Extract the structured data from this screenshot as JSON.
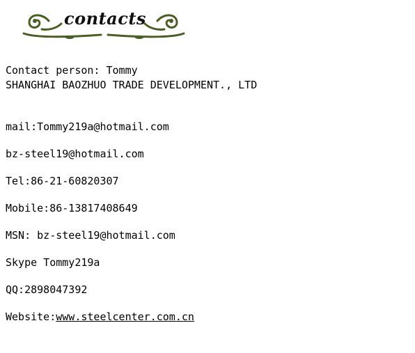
{
  "header": {
    "title": "contacts",
    "ornament_color": "#4a5e23"
  },
  "contact": {
    "person_line": "Contact person: Tommy",
    "company_line": "SHANGHAI BAOZHUO TRADE DEVELOPMENT., LTD",
    "mail_line": "mail:Tommy219a@hotmail.com",
    "mail2_line": "bz-steel19@hotmail.com",
    "tel_line": "Tel:86-21-60820307",
    "mobile_line": "Mobile:86-13817408649",
    "msn_line": "MSN: bz-steel19@hotmail.com",
    "skype_line": "Skype Tommy219a",
    "qq_line": "QQ:2898047392",
    "website_label": "Website:",
    "website_url": "www.steelcenter.com.cn"
  }
}
